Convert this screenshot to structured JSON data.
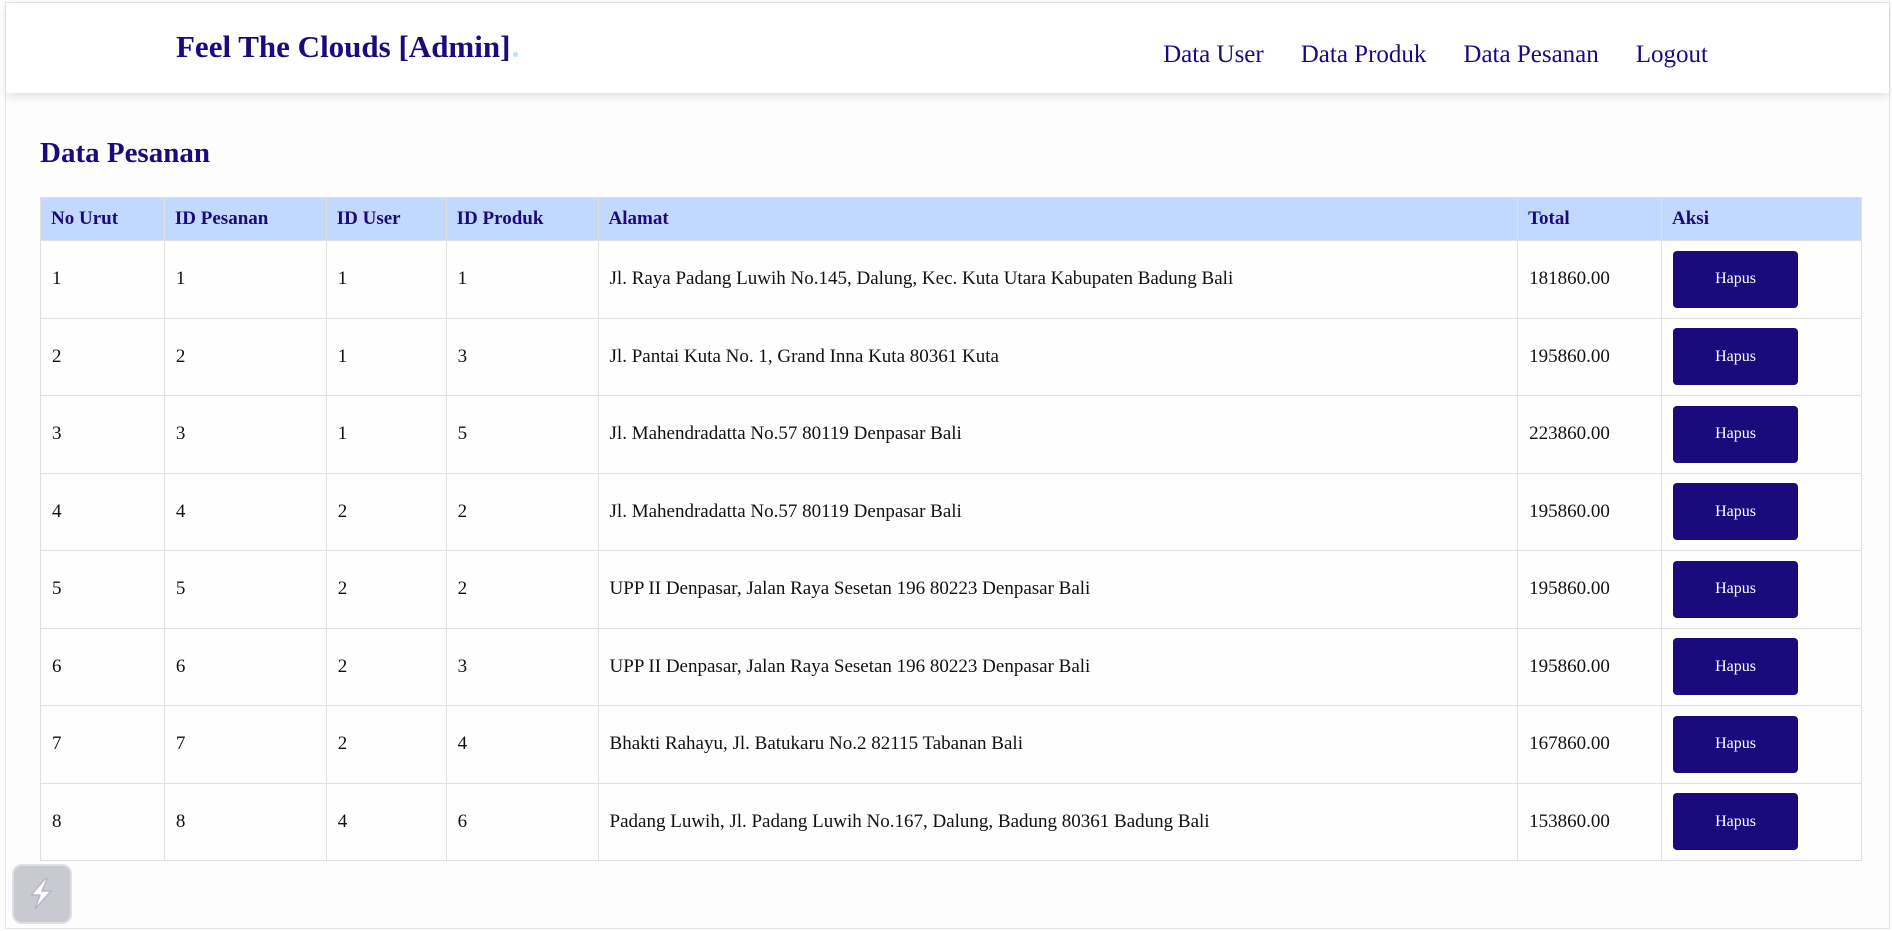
{
  "navbar": {
    "brand": "Feel The Clouds [Admin]",
    "links": [
      "Data User",
      "Data Produk",
      "Data Pesanan",
      "Logout"
    ]
  },
  "page": {
    "title": "Data Pesanan"
  },
  "table": {
    "headers": [
      "No Urut",
      "ID Pesanan",
      "ID User",
      "ID Produk",
      "Alamat",
      "Total",
      "Aksi"
    ],
    "action_label": "Hapus",
    "rows": [
      [
        "1",
        "1",
        "1",
        "1",
        "Jl. Raya Padang Luwih No.145, Dalung, Kec. Kuta Utara Kabupaten Badung Bali",
        "181860.00"
      ],
      [
        "2",
        "2",
        "1",
        "3",
        "Jl. Pantai Kuta No. 1, Grand Inna Kuta 80361 Kuta",
        "195860.00"
      ],
      [
        "3",
        "3",
        "1",
        "5",
        "Jl. Mahendradatta No.57 80119 Denpasar Bali",
        "223860.00"
      ],
      [
        "4",
        "4",
        "2",
        "2",
        "Jl. Mahendradatta No.57 80119 Denpasar Bali",
        "195860.00"
      ],
      [
        "5",
        "5",
        "2",
        "2",
        "UPP II Denpasar, Jalan Raya Sesetan 196 80223 Denpasar Bali",
        "195860.00"
      ],
      [
        "6",
        "6",
        "2",
        "3",
        "UPP II Denpasar, Jalan Raya Sesetan 196 80223 Denpasar Bali",
        "195860.00"
      ],
      [
        "7",
        "7",
        "2",
        "4",
        "Bhakti Rahayu, Jl. Batukaru No.2 82115 Tabanan Bali",
        "167860.00"
      ],
      [
        "8",
        "8",
        "4",
        "6",
        "Padang Luwih, Jl. Padang Luwih No.167, Dalung, Badung 80361 Badung Bali",
        "153860.00"
      ]
    ]
  },
  "colors": {
    "brand": "#1a0a7c",
    "header_bg": "#c2d8ff",
    "button_bg": "#1a0a7c"
  },
  "icons": {
    "corner_widget": "lightning-bolt-icon"
  }
}
